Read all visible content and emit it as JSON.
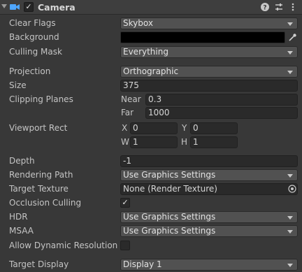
{
  "header": {
    "title": "Camera",
    "enabled_check": "✓",
    "icons": [
      "camera-icon",
      "help-icon",
      "preset-icon",
      "context-menu-icon"
    ]
  },
  "fields": {
    "clear_flags": {
      "label": "Clear Flags",
      "value": "Skybox"
    },
    "background": {
      "label": "Background",
      "color": "#000000"
    },
    "culling_mask": {
      "label": "Culling Mask",
      "value": "Everything"
    },
    "projection": {
      "label": "Projection",
      "value": "Orthographic"
    },
    "size": {
      "label": "Size",
      "value": "375"
    },
    "clipping_planes": {
      "label": "Clipping Planes",
      "near_label": "Near",
      "near": "0.3",
      "far_label": "Far",
      "far": "1000"
    },
    "viewport_rect": {
      "label": "Viewport Rect",
      "x_label": "X",
      "x": "0",
      "y_label": "Y",
      "y": "0",
      "w_label": "W",
      "w": "1",
      "h_label": "H",
      "h": "1"
    },
    "depth": {
      "label": "Depth",
      "value": "-1"
    },
    "rendering_path": {
      "label": "Rendering Path",
      "value": "Use Graphics Settings"
    },
    "target_texture": {
      "label": "Target Texture",
      "value": "None (Render Texture)"
    },
    "occlusion_culling": {
      "label": "Occlusion Culling",
      "checked": true,
      "check": "✓"
    },
    "hdr": {
      "label": "HDR",
      "value": "Use Graphics Settings"
    },
    "msaa": {
      "label": "MSAA",
      "value": "Use Graphics Settings"
    },
    "allow_dynamic_resolution": {
      "label": "Allow Dynamic Resolution",
      "checked": false
    },
    "target_display": {
      "label": "Target Display",
      "value": "Display 1"
    }
  },
  "colors": {
    "panel": "#383838",
    "accent_icon": "#4ea6ff"
  }
}
